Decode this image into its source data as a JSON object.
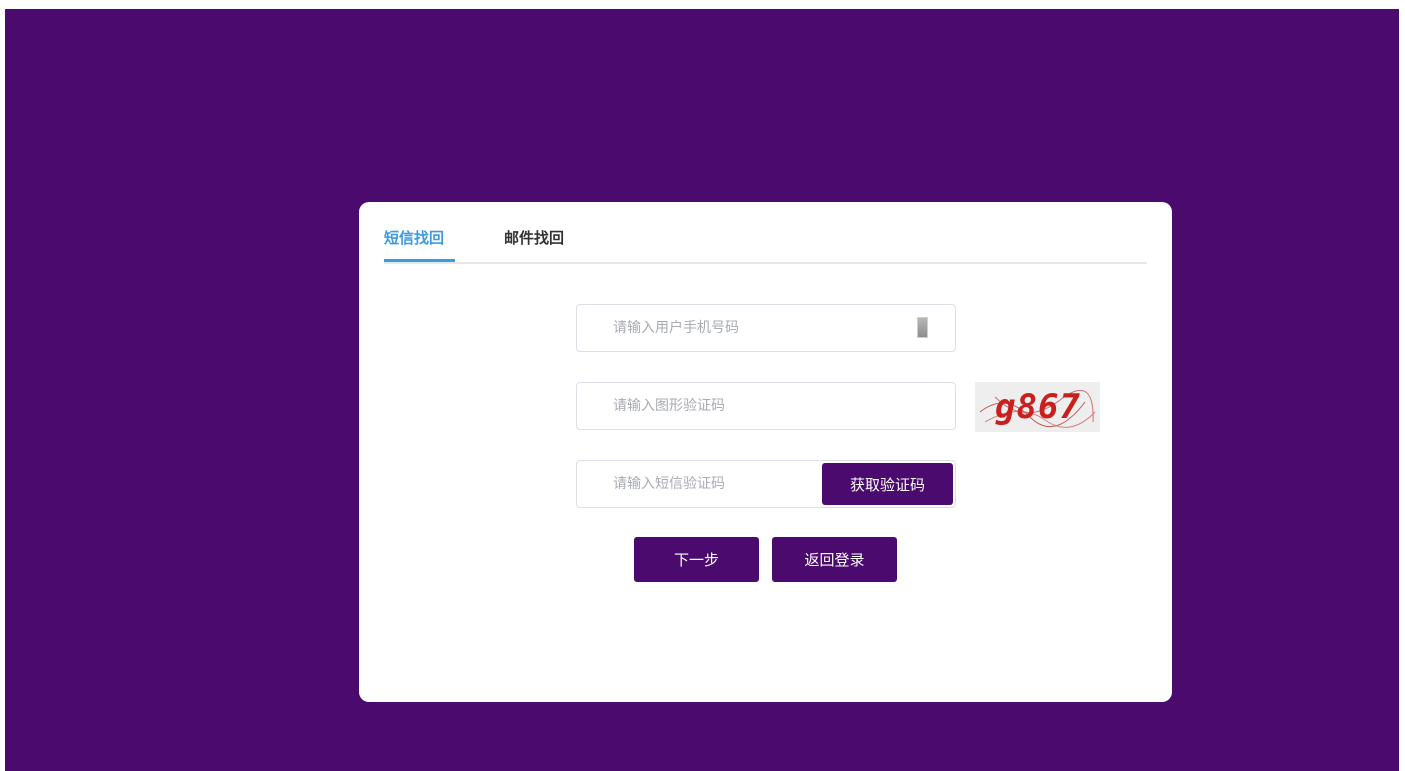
{
  "colors": {
    "background": "#4b0b6e",
    "card": "#ffffff",
    "accent": "#3d9be0",
    "button": "#4b0b6e"
  },
  "tabs": [
    {
      "label": "短信找回",
      "active": true
    },
    {
      "label": "邮件找回",
      "active": false
    }
  ],
  "form": {
    "phone": {
      "placeholder": "请输入用户手机号码",
      "value": "",
      "icon": "phone-icon"
    },
    "captcha": {
      "placeholder": "请输入图形验证码",
      "value": "",
      "image_text": "g867"
    },
    "sms": {
      "placeholder": "请输入短信验证码",
      "value": "",
      "button_label": "获取验证码"
    }
  },
  "actions": {
    "next_label": "下一步",
    "back_label": "返回登录"
  }
}
